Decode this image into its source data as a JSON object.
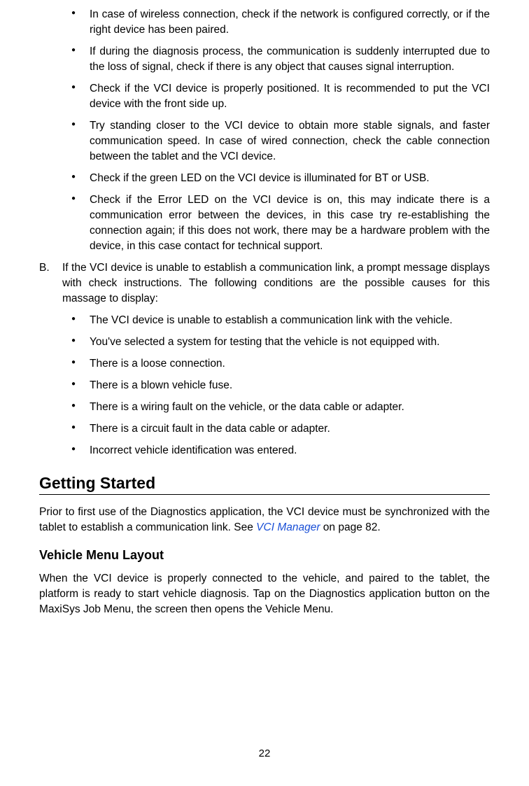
{
  "topBullets": [
    "In case of wireless connection, check if the network is configured correctly, or if the right device has been paired.",
    "If during the diagnosis process, the communication is suddenly interrupted due to the loss of signal, check if there is any object that causes signal interruption.",
    "Check if the VCI device is properly positioned. It is recommended to put the VCI device with the front side up.",
    "Try standing closer to the VCI device to obtain more stable signals, and faster communication speed. In case of wired connection, check the cable connection between the tablet and the VCI device.",
    "Check if the green LED on the VCI device is illuminated for BT or USB.",
    "Check if the Error LED on the VCI device is on, this may indicate there is a communication error between the devices, in this case try re-establishing the connection again; if this does not work, there may be a hardware problem with the device, in this case contact for technical support."
  ],
  "letteredLabel": "B.",
  "letteredText": "If the VCI device is unable to establish a communication link, a prompt message displays with check instructions. The following conditions are the possible causes for this massage to display:",
  "subBullets": [
    "The VCI device is unable to establish a communication link with the vehicle.",
    "You've selected a system for testing that the vehicle is not equipped with.",
    "There is a loose connection.",
    "There is a blown vehicle fuse.",
    "There is a wiring fault on the vehicle, or the data cable or adapter.",
    "There is a circuit fault in the data cable or adapter.",
    "Incorrect vehicle identification was entered."
  ],
  "sectionHeading": "Getting Started",
  "introPrefix": "Prior to first use of the Diagnostics application, the VCI device must be synchronized with the tablet to establish a communication link. See ",
  "introLink": "VCI Manager",
  "introSuffix": " on page 82.",
  "subHeading": "Vehicle Menu Layout",
  "bodyPara": "When the VCI device is properly connected to the vehicle, and paired to the tablet, the platform is ready to start vehicle diagnosis. Tap on the Diagnostics application button on the MaxiSys Job Menu, the screen then opens the Vehicle Menu.",
  "pageNumber": "22"
}
